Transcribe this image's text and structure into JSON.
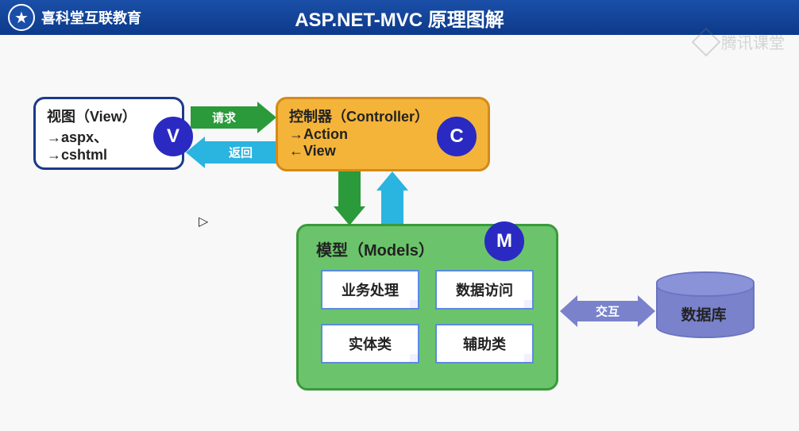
{
  "header": {
    "brand": "喜科堂互联教育",
    "title": "ASP.NET-MVC 原理图解"
  },
  "watermark": "腾讯课堂",
  "view": {
    "title": "视图（View）",
    "lines": [
      "→aspx、",
      "→cshtml"
    ],
    "badge": "V"
  },
  "controller": {
    "title": "控制器（Controller）",
    "lines": [
      "→Action",
      "←View"
    ],
    "badge": "C"
  },
  "models": {
    "title": "模型（Models）",
    "badge": "M",
    "items": [
      "业务处理",
      "数据访问",
      "实体类",
      "辅助类"
    ]
  },
  "arrows": {
    "request": "请求",
    "response": "返回",
    "interact": "交互"
  },
  "database": "数据库"
}
